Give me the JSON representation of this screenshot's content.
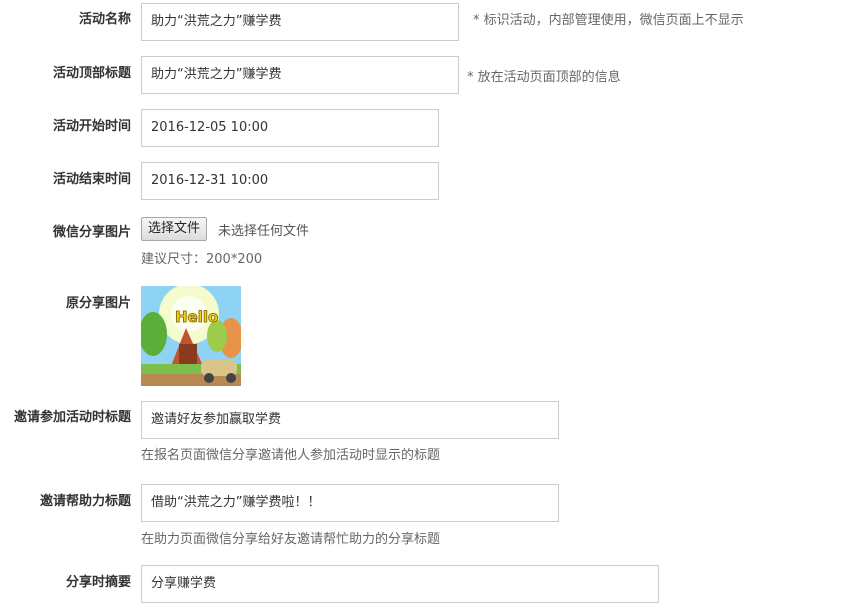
{
  "form": {
    "activity_name": {
      "label": "活动名称",
      "value": "助力“洪荒之力”赚学费",
      "hint": "* 标识活动，内部管理使用，微信页面上不显示"
    },
    "top_title": {
      "label": "活动顶部标题",
      "value": "助力“洪荒之力”赚学费",
      "hint": "* 放在活动页面顶部的信息"
    },
    "start_time": {
      "label": "活动开始时间",
      "value": "2016-12-05 10:00"
    },
    "end_time": {
      "label": "活动结束时间",
      "value": "2016-12-31 10:00"
    },
    "share_image": {
      "label": "微信分享图片",
      "button": "选择文件",
      "status": "未选择任何文件",
      "hint": "建议尺寸：200*200"
    },
    "original_image": {
      "label": "原分享图片",
      "image_text": "Hello"
    },
    "invite_join_title": {
      "label": "邀请参加活动时标题",
      "value": "邀请好友参加赢取学费",
      "hint": "在报名页面微信分享邀请他人参加活动时显示的标题"
    },
    "invite_help_title": {
      "label": "邀请帮助力标题",
      "value": "借助“洪荒之力”赚学费啦！！",
      "hint": "在助力页面微信分享给好友邀请帮忙助力的分享标题"
    },
    "share_summary": {
      "label": "分享时摘要",
      "value": "分享赚学费"
    }
  },
  "colors": {
    "border": "#cccccc",
    "label": "#333333",
    "hint": "#666666"
  }
}
